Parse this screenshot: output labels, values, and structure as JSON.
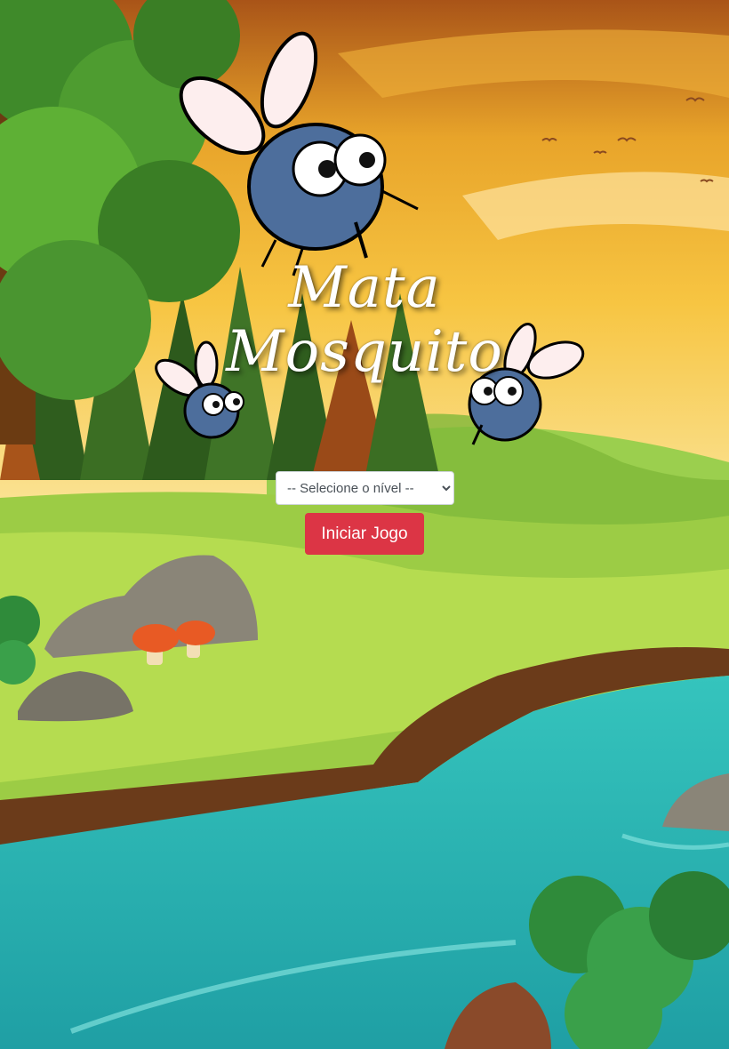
{
  "app": {
    "title_line1": "Mata",
    "title_line2": "Mosquito"
  },
  "level_select": {
    "selected": "-- Selecione o nível --",
    "options": [
      "-- Selecione o nível --"
    ]
  },
  "start_button": {
    "label": "Iniciar Jogo",
    "color": "#dc3545"
  },
  "colors": {
    "sky_top": "#b8621b",
    "sky_mid": "#f5b93a",
    "sky_low": "#f8e39a",
    "grass": "#8cc63f",
    "river": "#2ab5b0",
    "accent": "#dc3545"
  },
  "icons": [
    "mosquito-icon",
    "mushroom-icon",
    "rock-icon",
    "bush-icon",
    "tree-icon",
    "bird-icon"
  ]
}
